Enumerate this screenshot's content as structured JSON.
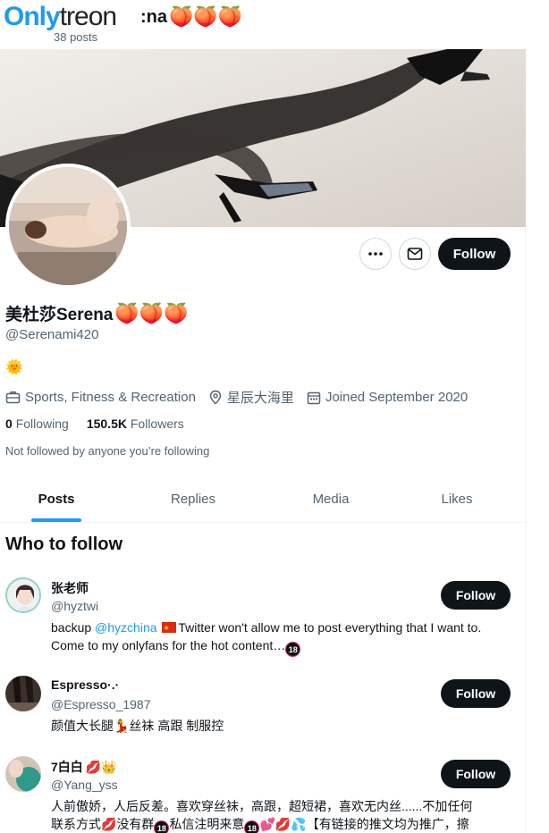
{
  "watermark": {
    "part1": "Only",
    "part2": "treon"
  },
  "header": {
    "name_suffix": ":na",
    "peaches": "🍑🍑🍑",
    "post_count": "38 posts"
  },
  "profile": {
    "display_name": "美杜莎Serena",
    "display_peaches": "🍑🍑🍑",
    "handle": "@Serenami420",
    "bio_emoji": "🌞",
    "category": "Sports, Fitness & Recreation",
    "location": "星辰大海里",
    "joined": "Joined September 2020",
    "following_count": "0",
    "following_label": "Following",
    "followers_count": "150.5K",
    "followers_label": "Followers",
    "not_followed": "Not followed by anyone you’re following"
  },
  "actions": {
    "follow_label": "Follow"
  },
  "tabs": [
    {
      "label": "Posts",
      "active": true
    },
    {
      "label": "Replies",
      "active": false
    },
    {
      "label": "Media",
      "active": false
    },
    {
      "label": "Likes",
      "active": false
    }
  ],
  "who_to_follow": {
    "title": "Who to follow",
    "users": [
      {
        "name": "张老师",
        "handle": "@hyztwi",
        "bio_prefix": "backup ",
        "bio_link": "@hyzchina",
        "bio_text": "Twitter won't allow me to post everything that I want to. Come to my onlyfans for the hot content…",
        "follow_label": "Follow"
      },
      {
        "name": "Espresso·.·",
        "handle": "@Espresso_1987",
        "bio_text": "颜值大长腿💃丝袜 高跟 制服控",
        "follow_label": "Follow"
      },
      {
        "name": "7白白",
        "name_emoji": "💋👑",
        "handle": "@Yang_yss",
        "bio_line1": "人前傲娇，人后反差。喜欢穿丝袜，高跟，超短裙，喜欢无内丝......不加任何",
        "bio_line2_a": "联系方式",
        "bio_line2_b": "没有群",
        "bio_line2_c": "私信注明来意",
        "bio_line2_d": "【有链接的推文均为推广，擦",
        "follow_label": "Follow"
      }
    ]
  },
  "colors": {
    "accent": "#1d9bf0",
    "text": "#0f1419",
    "muted": "#536471",
    "button": "#0f1419"
  }
}
